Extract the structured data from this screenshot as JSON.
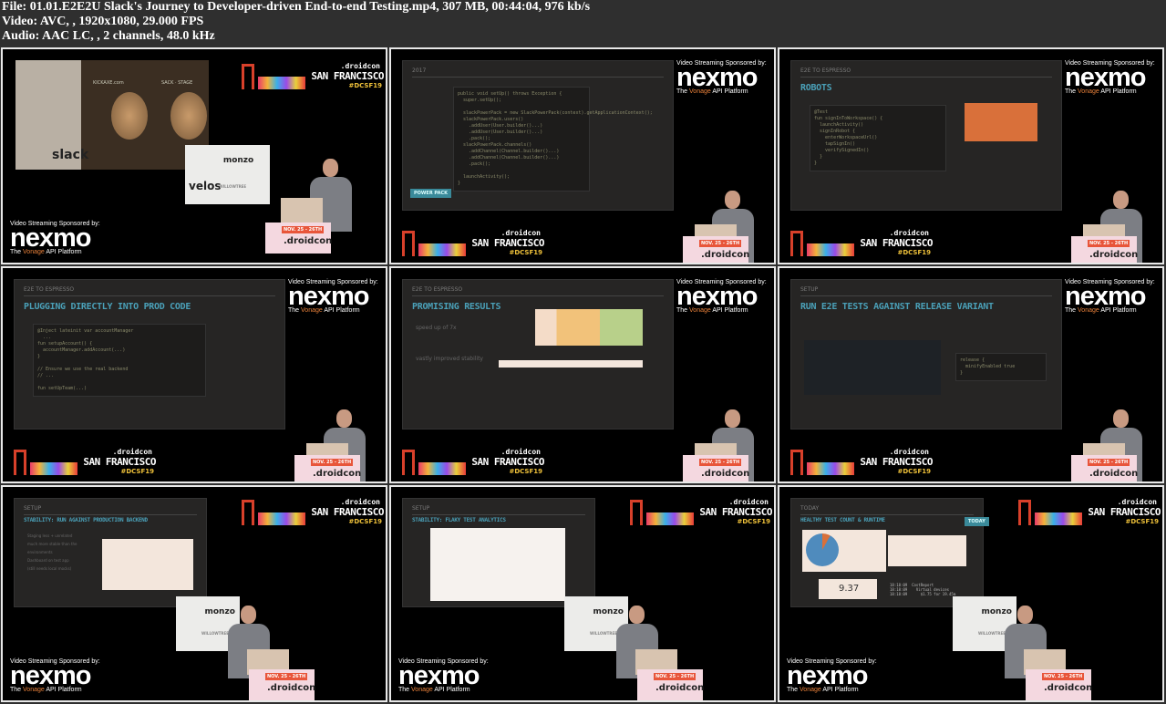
{
  "header": {
    "file_line": "File: 01.01.E2E2U Slack's Journey to Developer-driven End-to-end Testing.mp4, 307 MB, 00:44:04, 976 kb/s",
    "video_line": "Video: AVC, , 1920x1080, 29.000 FPS",
    "audio_line": "Audio: AAC LC, , 2 channels, 48.0 kHz"
  },
  "branding": {
    "sponsor_label": "Video Streaming Sponsored by:",
    "sponsor_logo": "nexmo",
    "sponsor_tagline_pre": "The ",
    "sponsor_tagline_brand": "Vonage",
    "sponsor_tagline_post": " API Platform",
    "conf_name": ".droidcon",
    "conf_city": "SAN FRANCISCO",
    "conf_hashtag": "#DCSF19",
    "banner_dates": "NOV. 25 - 26TH",
    "banner_name": ".droidcon",
    "sign_monzo": "monzo",
    "sign_velos": "velos",
    "sign_willowtree": "WILLOWTREE",
    "photo_brand": "slack",
    "photo_text1": "KICKAXE.com",
    "photo_text2": "SACK · STAGE"
  },
  "frames": [
    {
      "layout": "photo"
    },
    {
      "layout": "slide",
      "section": "2017",
      "title": "",
      "tag": "POWER PACK",
      "code": "public void setUp() throws Exception {\n  super.setUp();\n\n  slackPowerPack = new SlackPowerPack(context).getApplicationContext();\n  slackPowerPack.users()\n    .addUser(User.builder()...)\n    .addUser(User.builder()...)\n    .pack();\n  slackPowerPack.channels()\n    .addChannel(Channel.builder()...)\n    .addChannel(Channel.builder()...)\n    .pack();\n\n  launchActivity();\n}"
    },
    {
      "layout": "slide",
      "section": "E2E TO ESPRESSO",
      "title": "ROBOTS",
      "code": "@Test\nfun signInToWorkspace() {\n  launchActivity()\n  signInRobot {\n    enterWorkspaceUrl()\n    tapSignIn()\n    verifySignedIn()\n  }\n}"
    },
    {
      "layout": "slide",
      "section": "E2E TO ESPRESSO",
      "title": "PLUGGING DIRECTLY INTO PROD CODE",
      "code": "@Inject lateinit var accountManager\n  ...\nfun setupAccount() {\n  accountManager.addAccount(...)\n}\n\n// Ensure we use the real backend\n// ...\n\nfun setUpTeam(...)"
    },
    {
      "layout": "slide",
      "section": "E2E TO ESPRESSO",
      "title": "PROMISING RESULTS",
      "bullets": [
        "speed up of 7x",
        "vastly improved stability"
      ]
    },
    {
      "layout": "slide",
      "section": "SETUP",
      "title": "RUN E2E TESTS AGAINST RELEASE VARIANT",
      "code": "release {\n  minifyEnabled true\n}"
    },
    {
      "layout": "small",
      "section": "SETUP",
      "title": "STABILITY: RUN AGAINST PRODUCTION BACKEND",
      "bullets": [
        "Staging less + unrelated",
        "much more stable than the environments",
        "Dashboard on test app",
        "(still needs local mocks)"
      ]
    },
    {
      "layout": "small",
      "section": "SETUP",
      "title": "STABILITY: FLAKY TEST ANALYTICS"
    },
    {
      "layout": "small",
      "section": "TODAY",
      "title": "HEALTHY TEST COUNT & RUNTIME",
      "tag": "TODAY",
      "metric": "9.37",
      "log": "18:18:09  CostReport\n18:18:09    Virtual devices\n18:18:09      $1.75 for 19.45m"
    }
  ]
}
